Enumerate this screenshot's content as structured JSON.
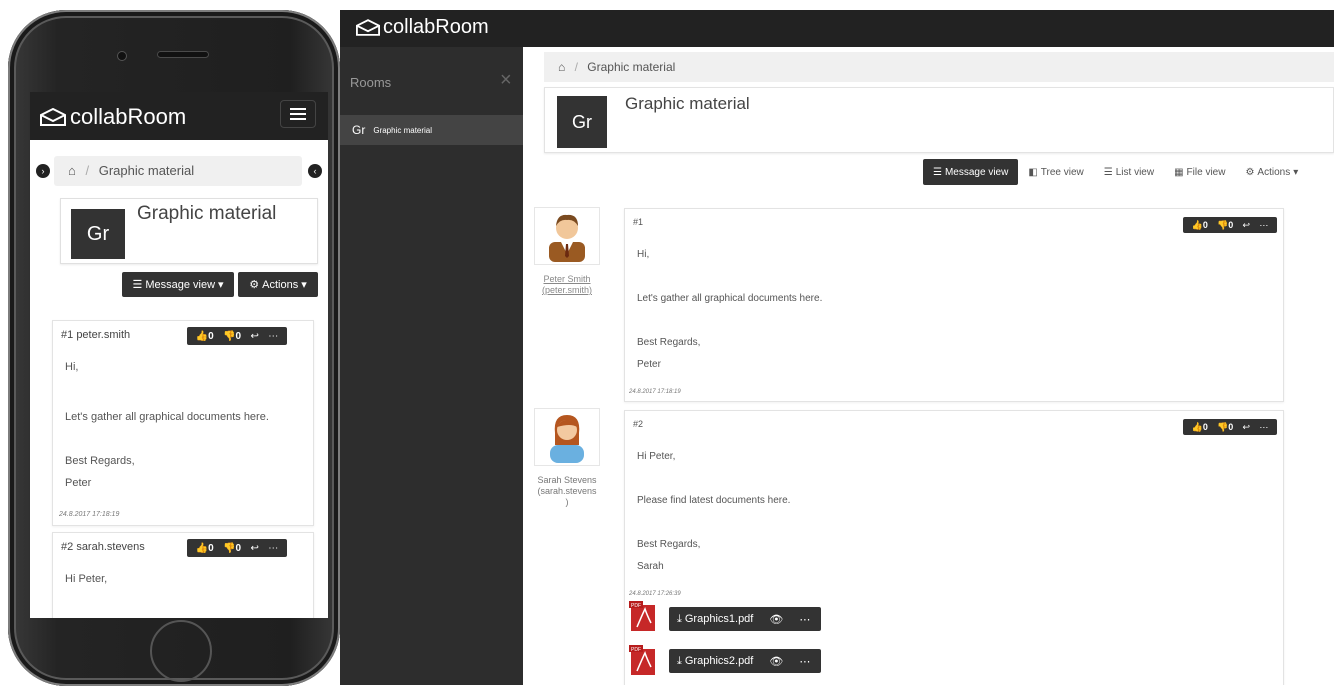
{
  "app": {
    "name": "collabRoom"
  },
  "sidebar": {
    "title": "Rooms",
    "close": "×",
    "items": [
      {
        "abbr": "Gr",
        "label": "Graphic material"
      }
    ]
  },
  "breadcrumb": {
    "home_icon": "home-icon",
    "separator": "/",
    "current": "Graphic material"
  },
  "room": {
    "abbr": "Gr",
    "title": "Graphic material"
  },
  "views": {
    "message": "Message view",
    "tree": "Tree view",
    "list": "List view",
    "file": "File view",
    "actions": "Actions",
    "active": "Message view"
  },
  "mobile": {
    "view_button": "Message view",
    "actions_button": "Actions"
  },
  "posts": [
    {
      "number": "#1",
      "username": "peter.smith",
      "author_line1": "Peter Smith",
      "author_line2": "(peter.smith)",
      "greeting": "Hi,",
      "body": "Let's gather all graphical documents here.",
      "closing": "Best Regards,",
      "signature": "Peter",
      "timestamp": "24.8.2017 17:18:19",
      "likes": "0",
      "dislikes": "0"
    },
    {
      "number": "#2",
      "username": "sarah.stevens",
      "author_line1": "Sarah Stevens",
      "author_line2": "(sarah.stevens",
      "author_line3": ")",
      "greeting": "Hi Peter,",
      "body": "Please find latest documents here.",
      "closing": "Best Regards,",
      "signature": "Sarah",
      "timestamp": "24.8.2017 17:26:39",
      "likes": "0",
      "dislikes": "0",
      "files": [
        {
          "name": "Graphics1.pdf"
        },
        {
          "name": "Graphics2.pdf"
        }
      ]
    }
  ],
  "colors": {
    "dark": "#333333",
    "navbar": "#222222",
    "sidebar": "#2d2d2d",
    "pdf_red": "#c62828"
  }
}
